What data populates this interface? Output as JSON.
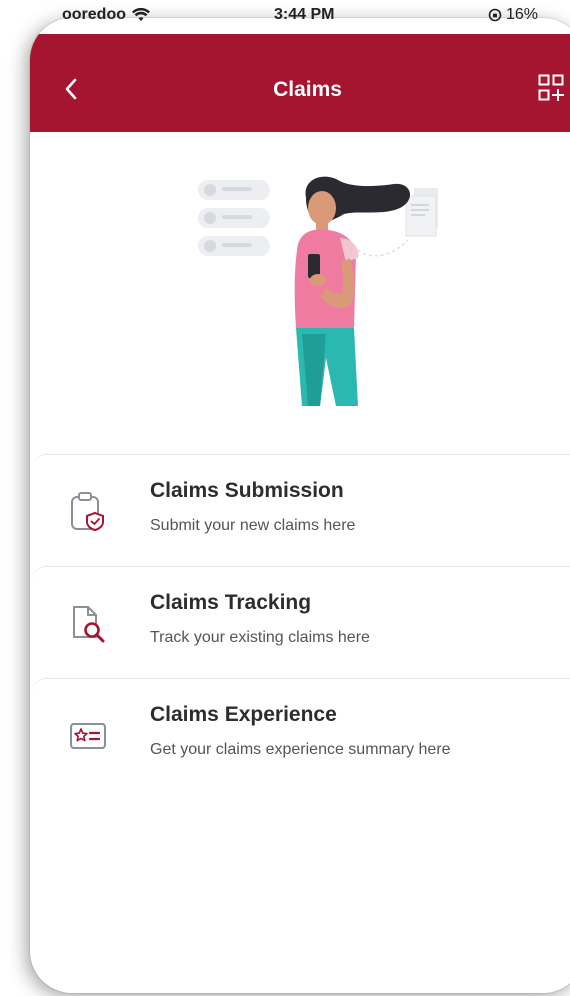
{
  "status_bar": {
    "carrier": "ooredoo",
    "time": "3:44 PM",
    "battery": "16%"
  },
  "header": {
    "title": "Claims",
    "back_icon": "chevron-left-icon",
    "action_icon": "add-widget-icon"
  },
  "colors": {
    "brand": "#a61530",
    "text_primary": "#2d2d2d",
    "text_secondary": "#555555"
  },
  "menu": {
    "items": [
      {
        "title": "Claims Submission",
        "subtitle": "Submit your new claims here",
        "icon": "clipboard-shield-icon"
      },
      {
        "title": "Claims Tracking",
        "subtitle": "Track your existing claims here",
        "icon": "document-search-icon"
      },
      {
        "title": "Claims Experience",
        "subtitle": "Get your claims experience summary here",
        "icon": "star-rating-card-icon"
      }
    ]
  }
}
